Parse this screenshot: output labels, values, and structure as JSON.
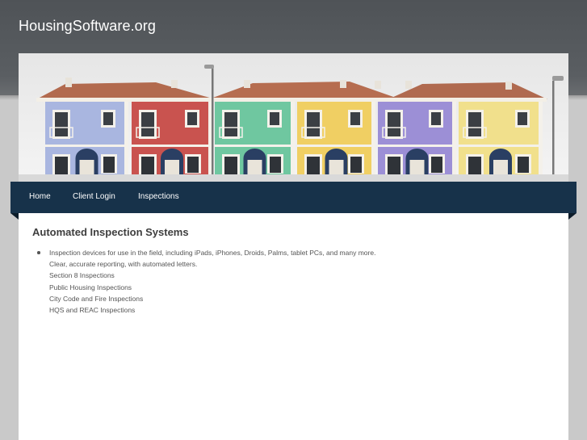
{
  "header": {
    "site_title": "HousingSoftware.org"
  },
  "banner": {
    "image": "row-of-colorful-townhouses-photo",
    "house_colors": [
      "#a9b6e0",
      "#c9534f",
      "#6fc7a0",
      "#f0cf63",
      "#9c8fd6",
      "#f1e08c"
    ]
  },
  "nav": {
    "items": [
      {
        "label": "Home"
      },
      {
        "label": "Client Login"
      },
      {
        "label": "Inspections"
      }
    ]
  },
  "main": {
    "heading": "Automated Inspection Systems",
    "list": [
      {
        "text": "Inspection devices for use in the field, including iPads, iPhones, Droids, Palms, tablet PCs, and many more.",
        "bullet": true
      },
      {
        "text": "Clear, accurate reporting, with automated letters.",
        "bullet": false
      },
      {
        "text": "Section 8 Inspections",
        "bullet": false
      },
      {
        "text": "Public Housing Inspections",
        "bullet": false
      },
      {
        "text": "City Code and Fire Inspections",
        "bullet": false
      },
      {
        "text": "HQS and REAC Inspections",
        "bullet": false
      }
    ]
  },
  "colors": {
    "header_bg": "#55595d",
    "nav_bg": "#17324a",
    "page_bg": "#c9c9c9",
    "content_bg": "#ffffff"
  }
}
